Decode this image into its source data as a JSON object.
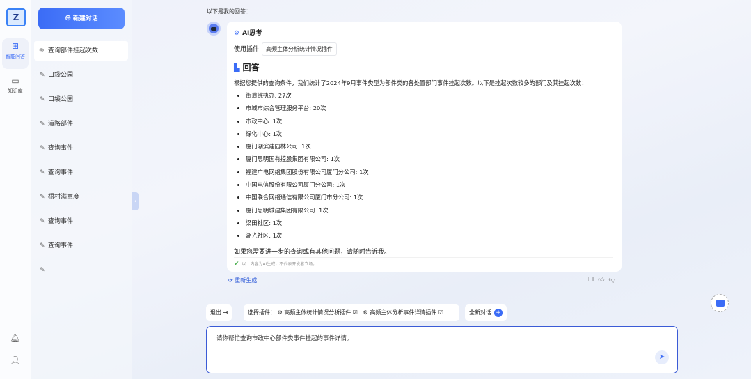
{
  "rail": {
    "items": [
      {
        "label": "智能问答",
        "icon": "grid-plus-icon"
      },
      {
        "label": "知识库",
        "icon": "folder-icon"
      }
    ]
  },
  "sidebar": {
    "new_chat": "新建对话",
    "history": [
      "查询部件挂起次数",
      "口袋公园",
      "口袋公园",
      "道路部件",
      "查询事件",
      "查询事件",
      "梧村满意度",
      "查询事件",
      "查询事件",
      ""
    ]
  },
  "chat": {
    "intro": "以下是我的回答：",
    "think_label": "AI思考",
    "plugin_label": "使用插件",
    "plugin_name": "高频主体分析统计情况插件",
    "answer_title": "回答",
    "paragraph": "根据您提供的查询条件，我们统计了2024年9月事件类型为部件类的各处置部门事件挂起次数。以下是挂起次数较多的部门及其挂起次数：",
    "items": [
      "街道综执办: 27次",
      "市城市综合管理服务平台: 20次",
      "市政中心: 1次",
      "绿化中心: 1次",
      "厦门湖滨建园林公司: 1次",
      "厦门思明国有控股集团有限公司: 1次",
      "福建广电网络集团股份有限公司厦门分公司: 1次",
      "中国电信股份有限公司厦门分公司: 1次",
      "中国联合网络通信有限公司厦门市分公司: 1次",
      "厦门思明城建集团有限公司: 1次",
      "梁田社区: 1次",
      "湖光社区: 1次"
    ],
    "closing": "如果您需要进一步的查询或有其他问题，请随时告诉我。",
    "disclaimer": "以上内容为AI生成，不代表开发者立场。",
    "regenerate": "重新生成"
  },
  "toolbar": {
    "exit": "退出",
    "select_plugin": "选择插件：",
    "plugins": [
      "高频主体统计情况分析插件",
      "高频主体分析事件详情插件"
    ],
    "new_chat": "全新对话"
  },
  "input": {
    "value": "请你帮忙查询市政中心部件类事件挂起的事件详情。"
  }
}
